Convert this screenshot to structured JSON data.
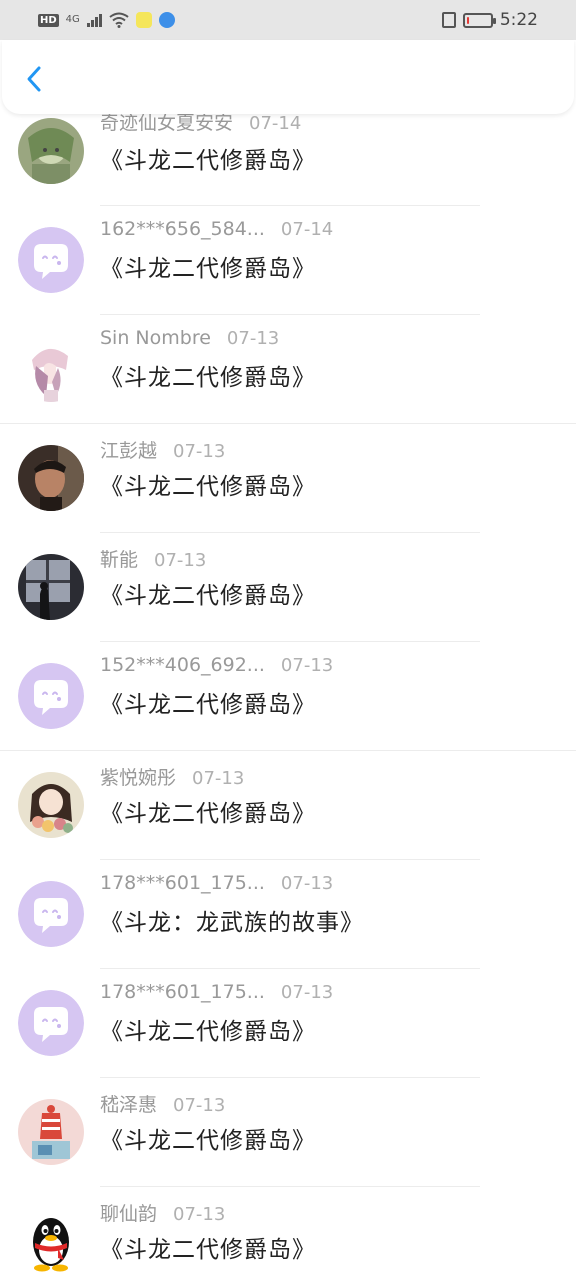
{
  "status": {
    "time": "5:22",
    "signal": "4G",
    "hd": "HD",
    "battery_level": 0.1,
    "battery_color": "#e53935"
  },
  "header": {
    "back_icon": "chevron-left-icon",
    "accent": "#2196f3"
  },
  "messages": [
    {
      "name": "奇迹仙女夏安安",
      "date": "07-14",
      "text": "《斗龙二代修爵岛》",
      "avatar": "anime-green"
    },
    {
      "name": "162***656_584...",
      "date": "07-14",
      "text": "《斗龙二代修爵岛》",
      "avatar": "default-chat"
    },
    {
      "name": "Sin Nombre",
      "date": "07-13",
      "text": "《斗龙二代修爵岛》",
      "avatar": "anime-girl-pink"
    },
    {
      "name": "江彭越",
      "date": "07-13",
      "text": "《斗龙二代修爵岛》",
      "avatar": "photo-man"
    },
    {
      "name": "靳能",
      "date": "07-13",
      "text": "《斗龙二代修爵岛》",
      "avatar": "photo-window"
    },
    {
      "name": "152***406_692...",
      "date": "07-13",
      "text": "《斗龙二代修爵岛》",
      "avatar": "default-chat"
    },
    {
      "name": "紫悦婉彤",
      "date": "07-13",
      "text": "《斗龙二代修爵岛》",
      "avatar": "anime-girl-flowers"
    },
    {
      "name": "178***601_175...",
      "date": "07-13",
      "text": "《斗龙：龙武族的故事》",
      "avatar": "default-chat"
    },
    {
      "name": "178***601_175...",
      "date": "07-13",
      "text": "《斗龙二代修爵岛》",
      "avatar": "default-chat"
    },
    {
      "name": "嵇泽惠",
      "date": "07-13",
      "text": "《斗龙二代修爵岛》",
      "avatar": "cartoon-red"
    },
    {
      "name": "聊仙韵",
      "date": "07-13",
      "text": "《斗龙二代修爵岛》",
      "avatar": "qq-penguin"
    }
  ]
}
